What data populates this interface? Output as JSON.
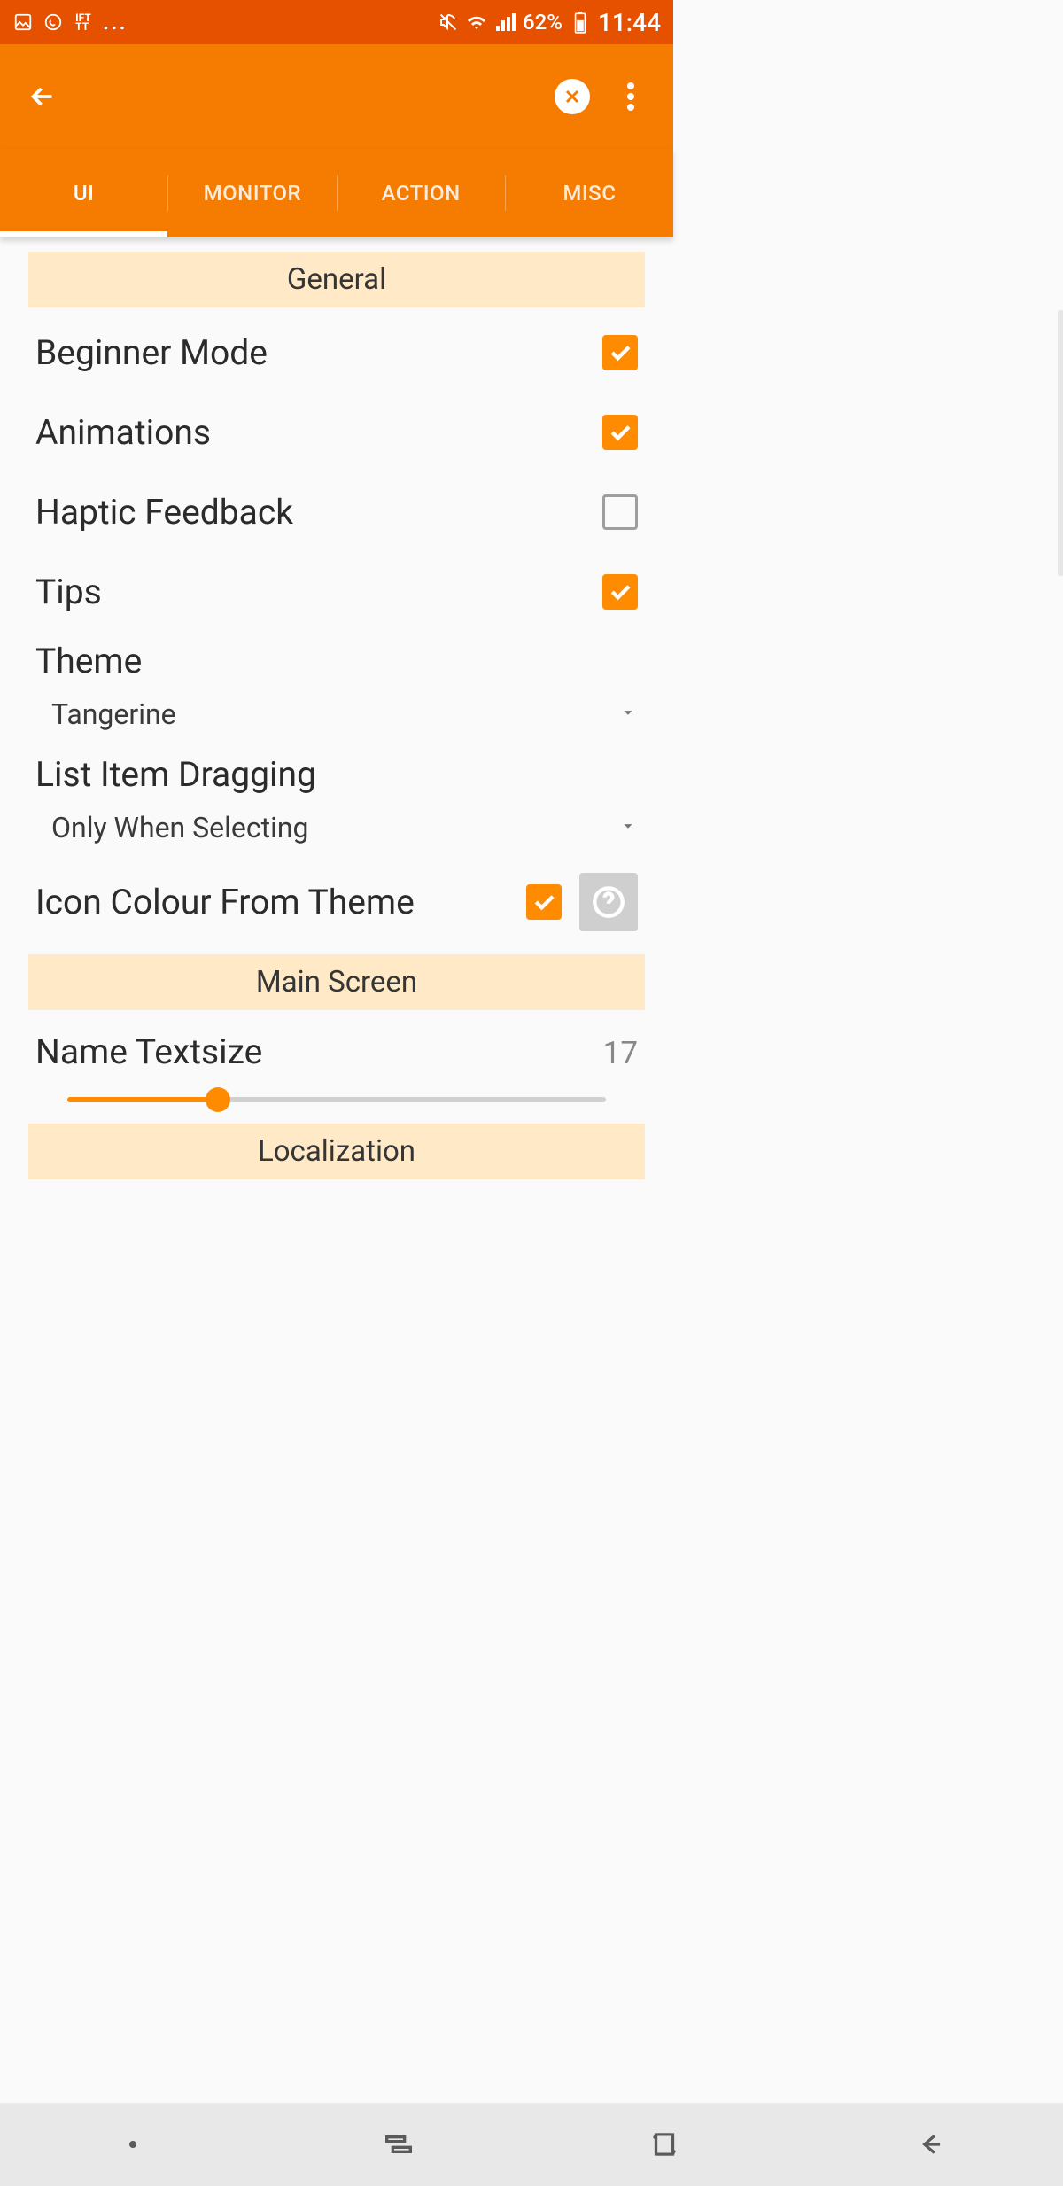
{
  "status": {
    "battery": "62%",
    "time": "11:44"
  },
  "tabs": {
    "items": [
      "UI",
      "MONITOR",
      "ACTION",
      "MISC"
    ],
    "active": 0
  },
  "sections": {
    "general": {
      "header": "General",
      "items": {
        "beginner": {
          "label": "Beginner Mode",
          "checked": true
        },
        "animations": {
          "label": "Animations",
          "checked": true
        },
        "haptic": {
          "label": "Haptic Feedback",
          "checked": false
        },
        "tips": {
          "label": "Tips",
          "checked": true
        },
        "theme": {
          "label": "Theme",
          "value": "Tangerine"
        },
        "dragging": {
          "label": "List Item Dragging",
          "value": "Only When Selecting"
        },
        "iconcolour": {
          "label": "Icon Colour From Theme",
          "checked": true
        }
      }
    },
    "mainscreen": {
      "header": "Main Screen",
      "textsize": {
        "label": "Name Textsize",
        "value": "17"
      }
    },
    "localization": {
      "header": "Localization"
    }
  },
  "colors": {
    "accent": "#ff8c00",
    "appbar": "#f57c00",
    "status": "#e65100",
    "section": "#ffe9c6"
  }
}
